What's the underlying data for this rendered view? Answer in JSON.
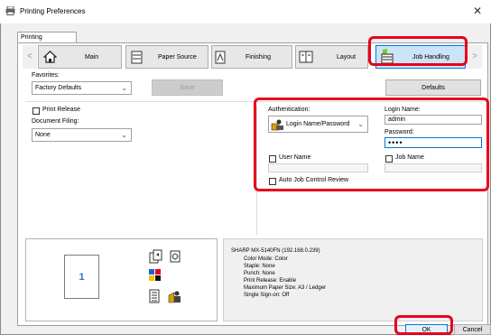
{
  "window": {
    "title": "Printing Preferences",
    "close": "✕"
  },
  "tab_label": "Printing Preferences",
  "tabs": [
    {
      "label": "Main",
      "icon": "home-icon"
    },
    {
      "label": "Paper Source",
      "icon": "paper-tray-icon"
    },
    {
      "label": "Finishing",
      "icon": "finishing-icon"
    },
    {
      "label": "Layout",
      "icon": "layout-icon"
    },
    {
      "label": "Job Handling",
      "icon": "job-handling-icon"
    }
  ],
  "nav": {
    "prev": "<",
    "next": ">"
  },
  "favorites": {
    "label": "Favorites:",
    "value": "Factory Defaults",
    "save": "Save",
    "defaults": "Defaults"
  },
  "print_release": "Print Release",
  "document_filing": {
    "label": "Document Filing:",
    "value": "None"
  },
  "authentication": {
    "label": "Authentication:",
    "value": "Login Name/Password"
  },
  "login_name": {
    "label": "Login Name:",
    "value": "admin"
  },
  "password": {
    "label": "Password:",
    "value": "••••"
  },
  "user_name": "User Name",
  "job_name": "Job Name",
  "auto_job_control": "Auto Job Control Review",
  "preview": {
    "page_number": "1"
  },
  "summary": {
    "lines": [
      "SHARP MX-5140FN (192.168.0.239)",
      "Color Mode: Color",
      "Staple: None",
      "Punch: None",
      "Print Release: Enable",
      "Maximum Paper Size: A3 / Ledger",
      "Single Sign-on: Off"
    ]
  },
  "buttons": {
    "ok": "OK",
    "cancel": "Cancel"
  },
  "colors": {
    "highlight": "#e8001c",
    "accent": "#0078d7"
  }
}
